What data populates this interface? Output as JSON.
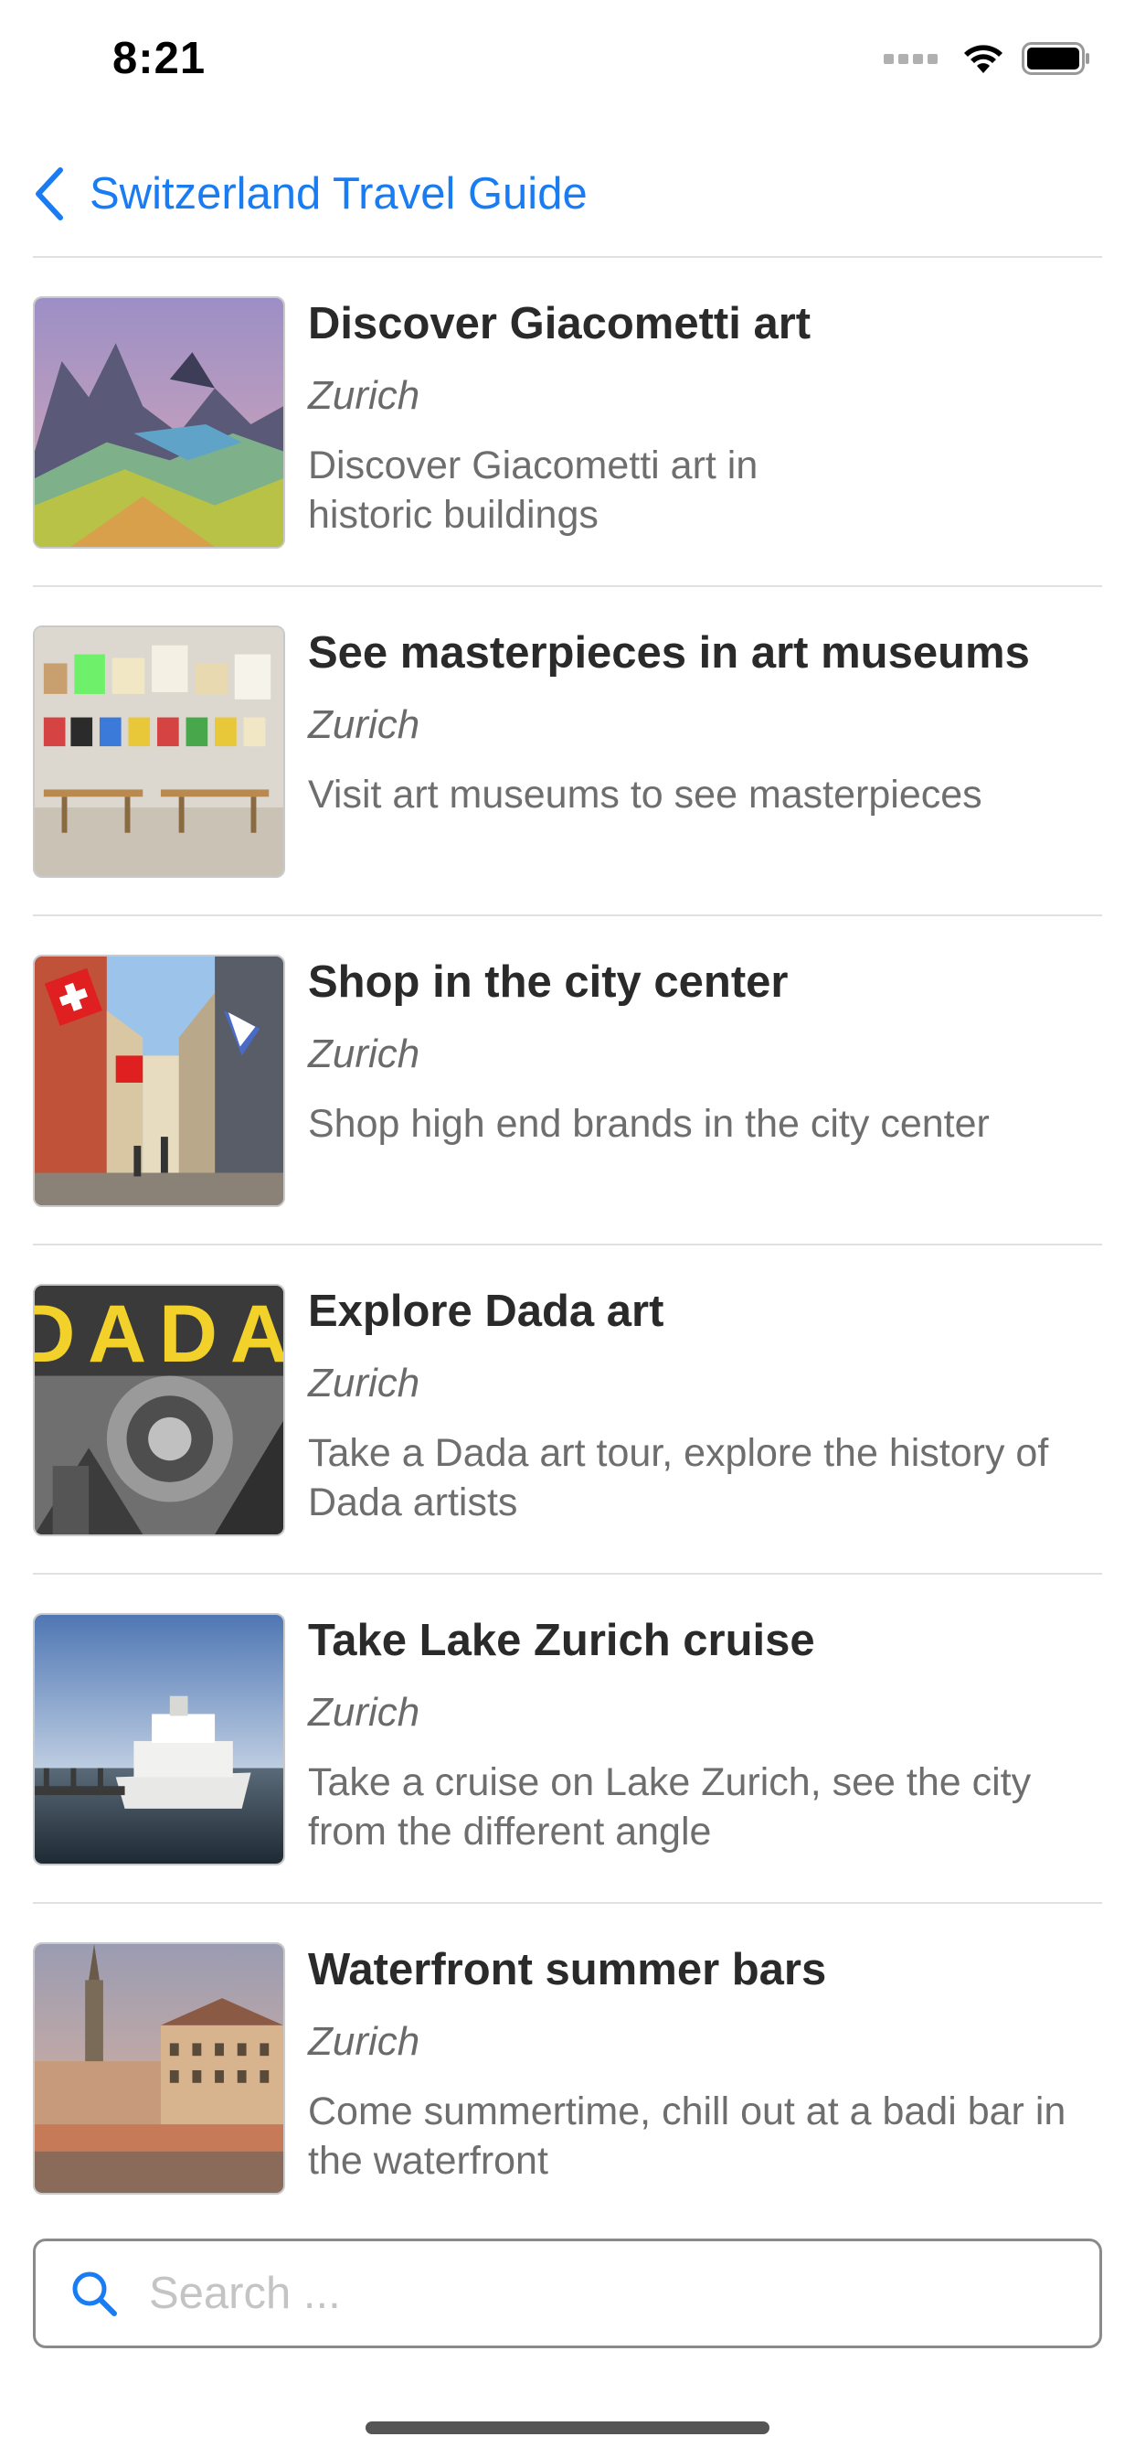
{
  "status_bar": {
    "time": "8:21"
  },
  "nav": {
    "back_label": "Switzerland Travel Guide",
    "accent_color": "#1a7cf2"
  },
  "items": [
    {
      "title": "Discover Giacometti art",
      "city": "Zurich",
      "description": "Discover Giacometti art in historic buildings",
      "thumb": "giacometti-painting"
    },
    {
      "title": "See masterpieces in art museums",
      "city": "Zurich",
      "description": "Visit art museums to see masterpieces",
      "thumb": "museum-wall"
    },
    {
      "title": "Shop in the city center",
      "city": "Zurich",
      "description": "Shop high end brands in the city center",
      "thumb": "street-with-flags"
    },
    {
      "title": "Explore Dada art",
      "city": "Zurich",
      "description": "Take a Dada art tour, explore the history of Dada artists",
      "thumb": "dada-poster",
      "thumb_text": "DADA"
    },
    {
      "title": "Take Lake Zurich cruise",
      "city": "Zurich",
      "description": "Take a cruise on Lake Zurich, see the city from the different angle",
      "thumb": "lake-boat"
    },
    {
      "title": "Waterfront summer bars",
      "city": "Zurich",
      "description": "Come summertime, chill out at a badi bar in the waterfront",
      "thumb": "waterfront-city"
    }
  ],
  "search": {
    "placeholder": "Search ...",
    "value": ""
  }
}
